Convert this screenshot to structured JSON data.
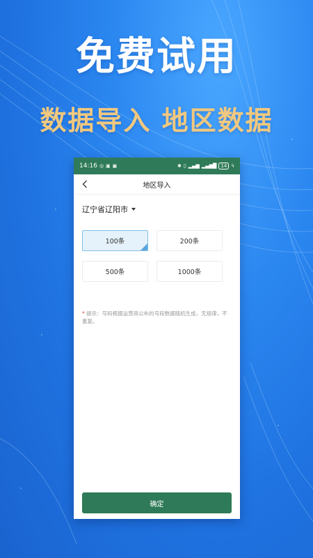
{
  "promo": {
    "headline": "免费试用",
    "subheadline": "数据导入 地区数据"
  },
  "status_bar": {
    "time": "14:16",
    "battery": "14"
  },
  "nav": {
    "back_icon": "chevron-left-icon",
    "title": "地区导入"
  },
  "region": {
    "selected": "辽宁省辽阳市"
  },
  "options": [
    {
      "label": "100条",
      "selected": true
    },
    {
      "label": "200条",
      "selected": false
    },
    {
      "label": "500条",
      "selected": false
    },
    {
      "label": "1000条",
      "selected": false
    }
  ],
  "tip": {
    "marker": "*",
    "text": " 提示：号码根据运营商公布的号段数据随机生成，无规律，不重复。"
  },
  "confirm_label": "确定",
  "colors": {
    "accent_green": "#2f7a58",
    "gold_text": "#f0c87f",
    "selected_bg": "#e5f2fb",
    "selected_border": "#7fc0ea"
  }
}
